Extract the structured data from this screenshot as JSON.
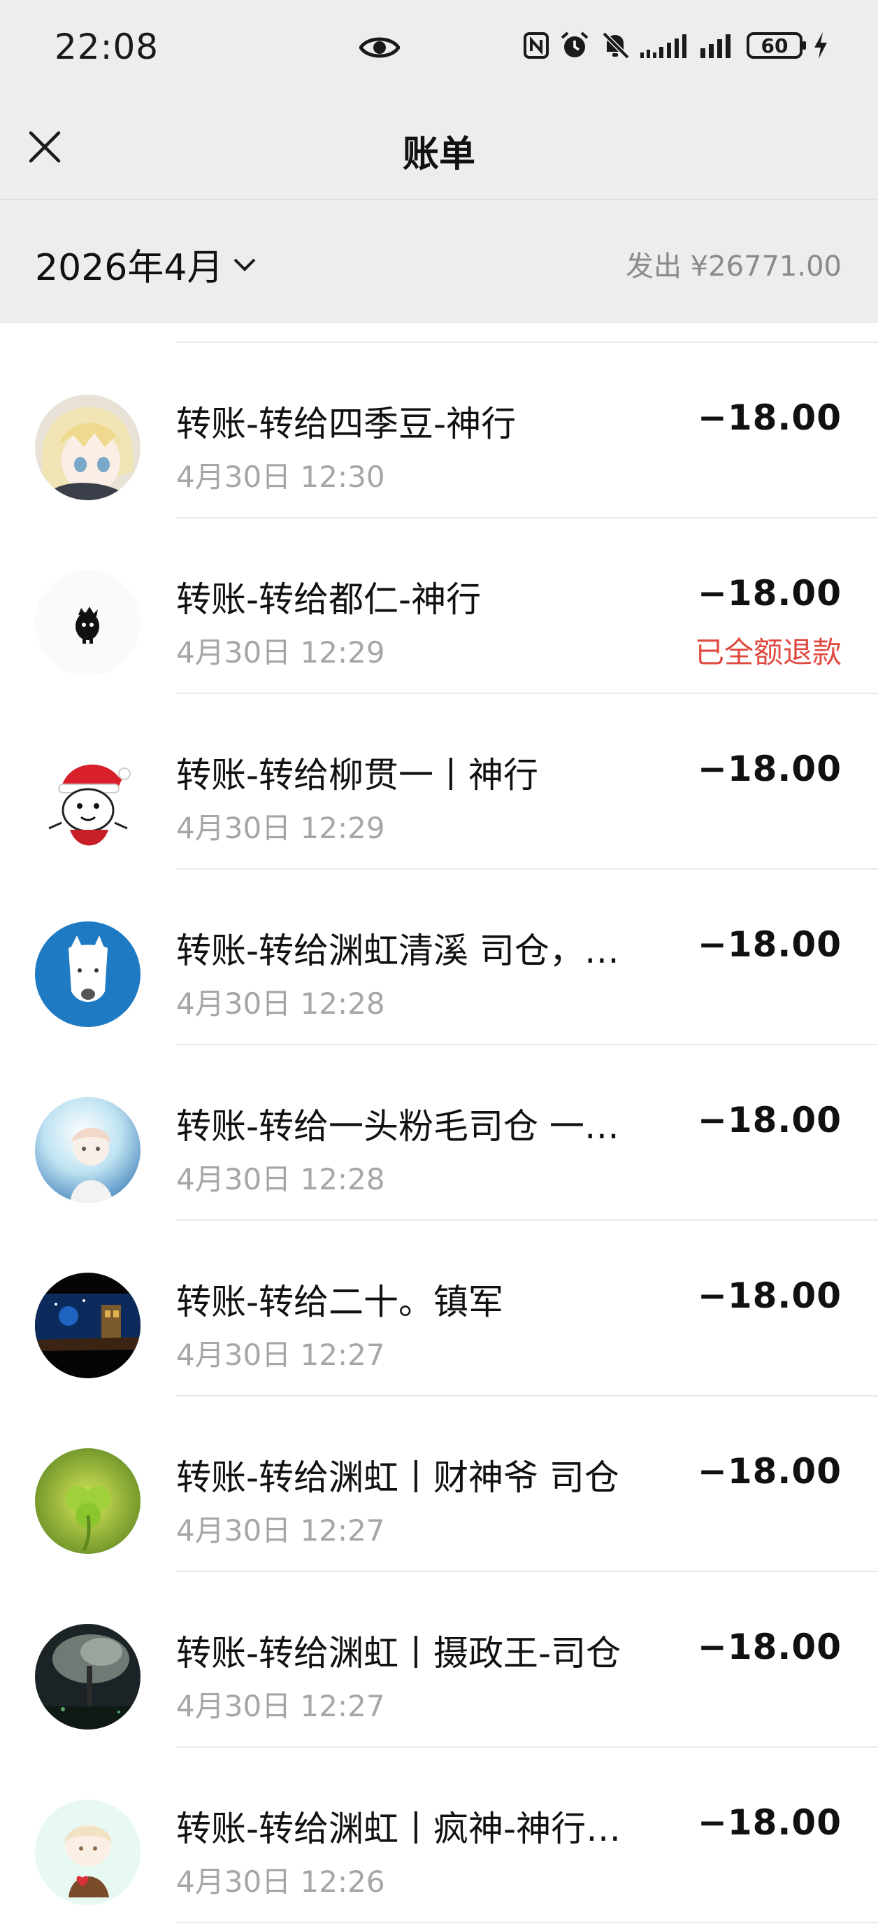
{
  "status_bar": {
    "time": "22:08",
    "battery": "60"
  },
  "header": {
    "title": "账单"
  },
  "filter": {
    "month": "2026年4月",
    "total": "发出 ¥26771.00"
  },
  "transactions": [
    {
      "title": "转账-转给四季豆-神行",
      "time": "4月30日 12:30",
      "amount": "−18.00",
      "note": ""
    },
    {
      "title": "转账-转给都仁-神行",
      "time": "4月30日 12:29",
      "amount": "−18.00",
      "note": "已全额退款"
    },
    {
      "title": "转账-转给柳贯一丨神行",
      "time": "4月30日 12:29",
      "amount": "−18.00",
      "note": ""
    },
    {
      "title": "转账-转给渊虹清溪 司仓，…",
      "time": "4月30日 12:28",
      "amount": "−18.00",
      "note": ""
    },
    {
      "title": "转账-转给一头粉毛司仓 一…",
      "time": "4月30日 12:28",
      "amount": "−18.00",
      "note": ""
    },
    {
      "title": "转账-转给二十。镇军",
      "time": "4月30日 12:27",
      "amount": "−18.00",
      "note": ""
    },
    {
      "title": "转账-转给渊虹丨财神爷 司仓",
      "time": "4月30日 12:27",
      "amount": "−18.00",
      "note": ""
    },
    {
      "title": "转账-转给渊虹丨摄政王-司仓",
      "time": "4月30日 12:27",
      "amount": "−18.00",
      "note": ""
    },
    {
      "title": "转账-转给渊虹丨疯神-神行…",
      "time": "4月30日 12:26",
      "amount": "−18.00",
      "note": ""
    }
  ],
  "colors": {
    "header_bg": "#ededed",
    "refund": "#e0493f",
    "secondary_text": "#a6a6a6"
  }
}
